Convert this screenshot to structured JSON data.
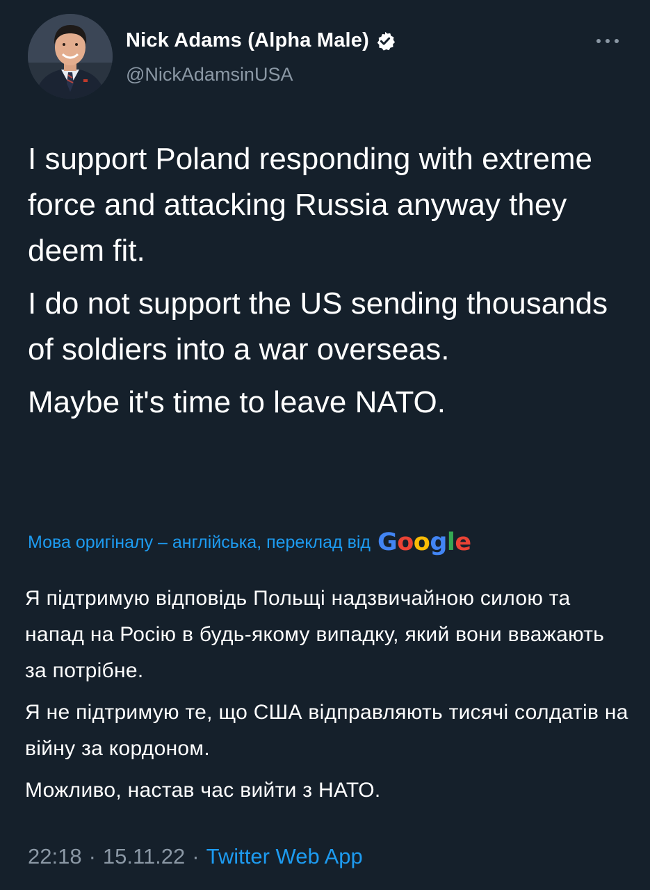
{
  "author": {
    "display_name": "Nick Adams (Alpha Male)",
    "handle": "@NickAdamsinUSA",
    "verified": true,
    "avatar_icon": "profile-photo"
  },
  "tweet": {
    "paragraphs": [
      "I support Poland responding with extreme force and attacking Russia anyway they deem fit.",
      "I do not support the US sending thousands of soldiers into a war overseas.",
      "Maybe it's time to leave NATO."
    ]
  },
  "translation": {
    "note": "Мова оригіналу – англійська, переклад від",
    "provider": "Google",
    "paragraphs": [
      "Я підтримую відповідь Польщі надзвичайною силою та напад на Росію в будь-якому випадку, який вони вважають за потрібне.",
      "Я не підтримую те, що США відправляють тисячі солдатів на війну за кордоном.",
      "Можливо, настав час вийти з НАТО."
    ]
  },
  "meta": {
    "time": "22:18",
    "separator": "·",
    "date": "15.11.22",
    "source": "Twitter Web App"
  },
  "colors": {
    "background": "#15202b",
    "accent": "#1d9bf0",
    "secondary_text": "#8b98a5"
  }
}
